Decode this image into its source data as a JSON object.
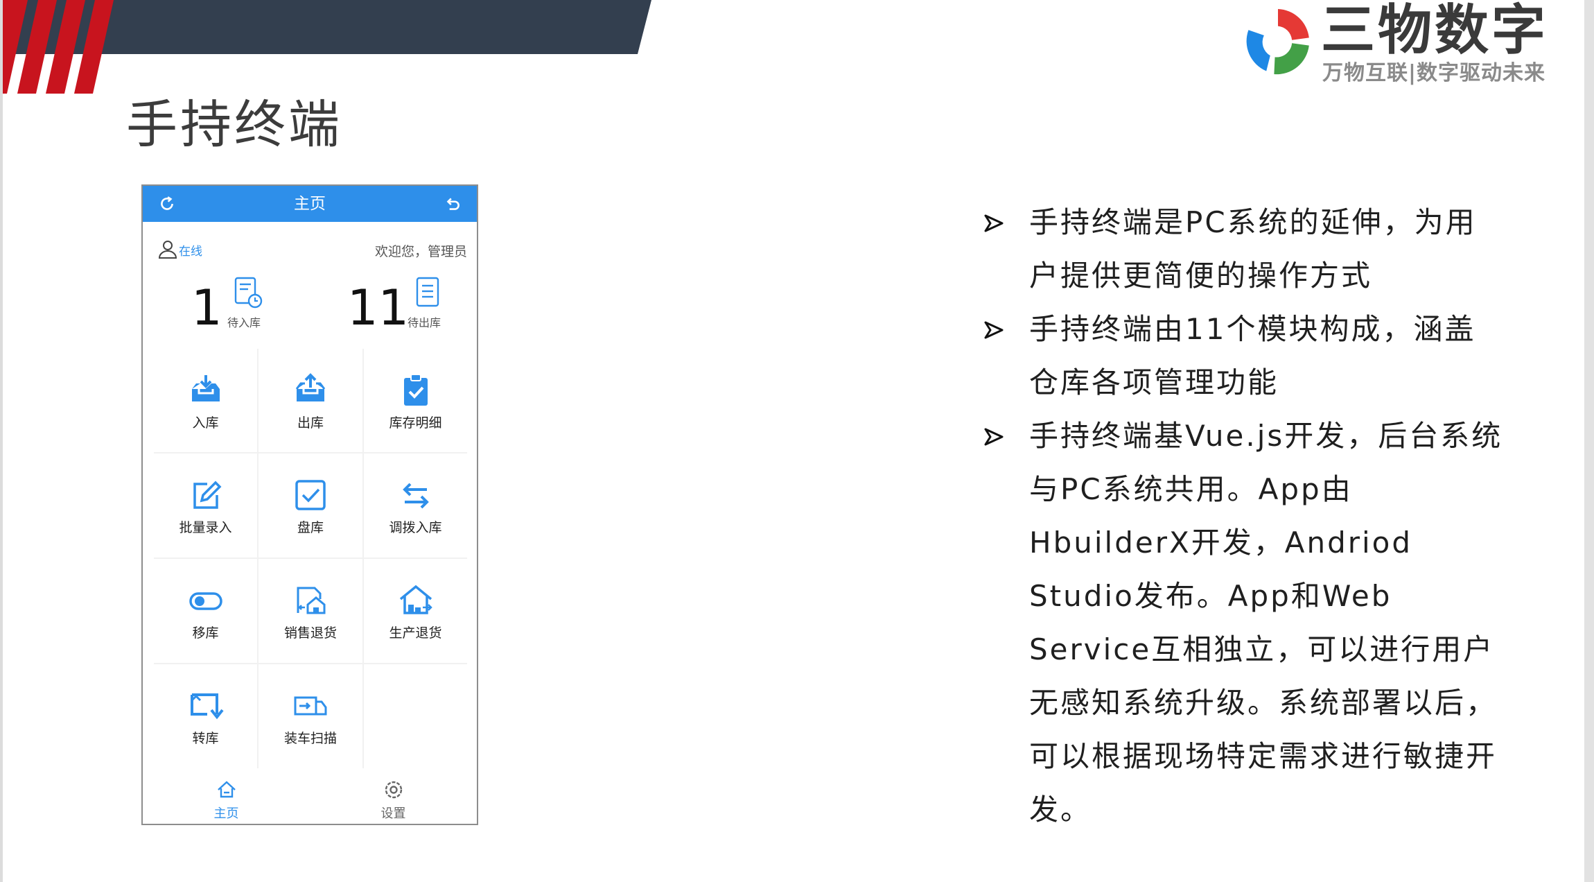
{
  "slide": {
    "title": "手持终端",
    "logo": {
      "name": "三物数字",
      "slogan": "万物互联|数字驱动未来",
      "colors": {
        "red": "#e53935",
        "blue": "#1e88e5",
        "green": "#43a047"
      }
    },
    "colors": {
      "dark_bar": "#333f4f",
      "red_stripes": "#c8141e",
      "accent_blue": "#2e8fea"
    }
  },
  "phone": {
    "header": {
      "title": "主页",
      "left_icon": "refresh-icon",
      "right_icon": "back-icon"
    },
    "status": {
      "online": "在线",
      "welcome": "欢迎您，管理员"
    },
    "stats": [
      {
        "value": "1",
        "label": "待入库",
        "icon": "inbound-doc-icon"
      },
      {
        "value": "11",
        "label": "待出库",
        "icon": "outbound-doc-icon"
      }
    ],
    "modules": [
      {
        "label": "入库",
        "icon": "inbox-in-icon"
      },
      {
        "label": "出库",
        "icon": "inbox-out-icon"
      },
      {
        "label": "库存明细",
        "icon": "clipboard-check-icon"
      },
      {
        "label": "批量录入",
        "icon": "edit-icon"
      },
      {
        "label": "盘库",
        "icon": "checkbox-icon"
      },
      {
        "label": "调拨入库",
        "icon": "transfer-arrows-icon"
      },
      {
        "label": "移库",
        "icon": "toggle-icon"
      },
      {
        "label": "销售退货",
        "icon": "sales-return-icon"
      },
      {
        "label": "生产退货",
        "icon": "production-return-icon"
      },
      {
        "label": "转库",
        "icon": "transfer-warehouse-icon"
      },
      {
        "label": "装车扫描",
        "icon": "truck-scan-icon"
      }
    ],
    "footer": [
      {
        "label": "主页",
        "icon": "home-icon",
        "active": true
      },
      {
        "label": "设置",
        "icon": "settings-icon",
        "active": false
      }
    ]
  },
  "bullets": [
    "手持终端是PC系统的延伸，为用户提供更简便的操作方式",
    "手持终端由11个模块构成，涵盖仓库各项管理功能",
    "手持终端基Vue.js开发，后台系统与PC系统共用。App由HbuilderX开发，Andriod Studio发布。App和Web Service互相独立，可以进行用户无感知系统升级。系统部署以后，可以根据现场特定需求进行敏捷开发。"
  ]
}
